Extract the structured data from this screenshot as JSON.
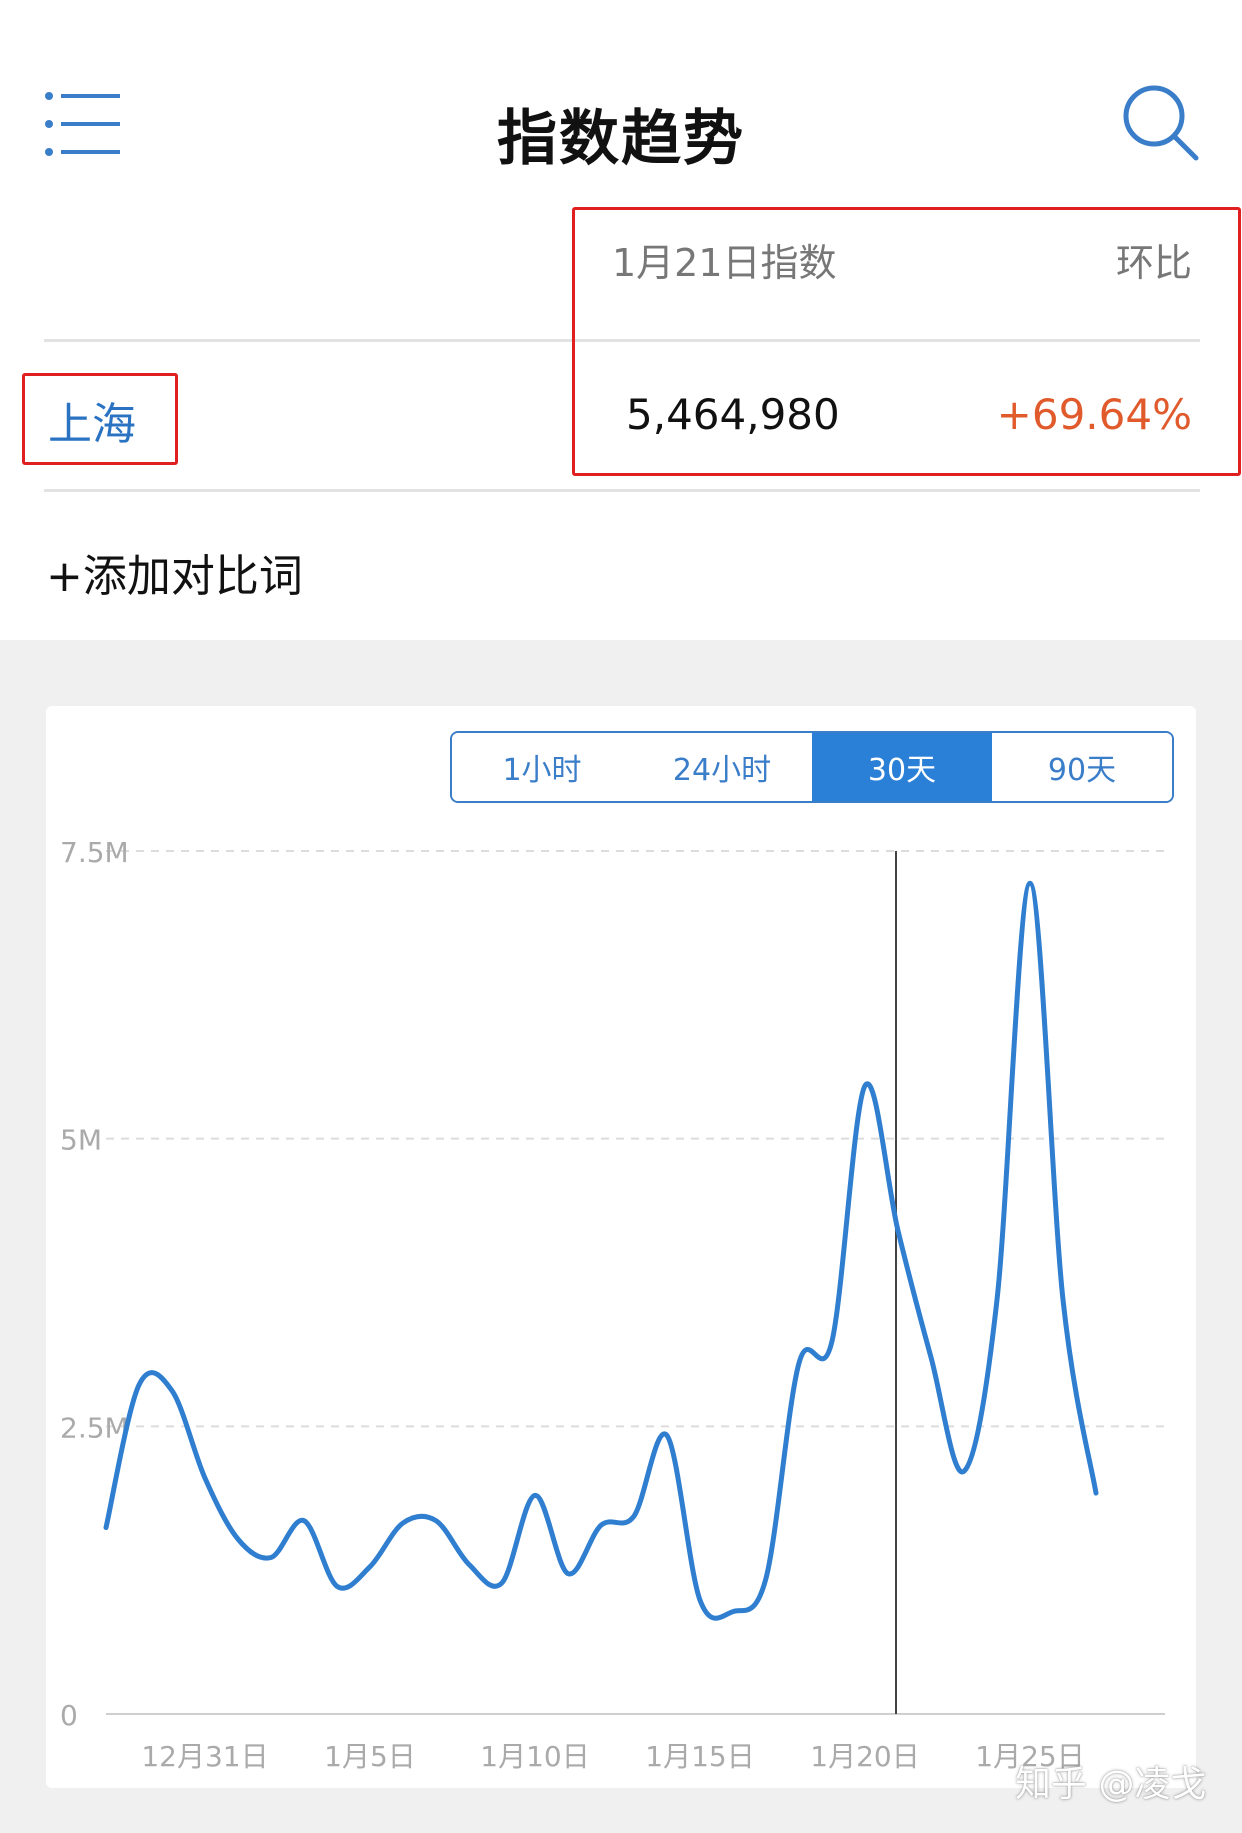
{
  "header": {
    "title": "指数趋势",
    "menu_icon": "list-icon",
    "search_icon": "search-icon"
  },
  "table": {
    "date_header": "1月21日指数",
    "change_header": "环比",
    "term": "上海",
    "value": "5,464,980",
    "change": "+69.64%"
  },
  "add_compare": "+添加对比词",
  "range_tabs": [
    {
      "label": "1小时",
      "active": false
    },
    {
      "label": "24小时",
      "active": false
    },
    {
      "label": "30天",
      "active": true
    },
    {
      "label": "90天",
      "active": false
    }
  ],
  "colors": {
    "accent": "#2a7fd6",
    "line": "#2f7ecf",
    "increase": "#e05a2c",
    "highlight": "#e02020"
  },
  "chart_data": {
    "type": "line",
    "ylim": [
      0,
      7500000
    ],
    "y_ticks": [
      {
        "value": 0,
        "label": "0"
      },
      {
        "value": 2500000,
        "label": "2.5M"
      },
      {
        "value": 5000000,
        "label": "5M"
      },
      {
        "value": 7500000,
        "label": "7.5M"
      }
    ],
    "x_ticks": [
      {
        "day": 5,
        "label": "12月31日"
      },
      {
        "day": 10,
        "label": "1月5日"
      },
      {
        "day": 15,
        "label": "1月10日"
      },
      {
        "day": 20,
        "label": "1月15日"
      },
      {
        "day": 25,
        "label": "1月20日"
      },
      {
        "day": 30,
        "label": "1月25日"
      }
    ],
    "grid": true,
    "marker_day": 26,
    "series": [
      {
        "values": [
          [
            2,
            1620000
          ],
          [
            3,
            2860000
          ],
          [
            4,
            2810000
          ],
          [
            5,
            2050000
          ],
          [
            6,
            1520000
          ],
          [
            7,
            1360000
          ],
          [
            8,
            1680000
          ],
          [
            9,
            1110000
          ],
          [
            10,
            1280000
          ],
          [
            11,
            1660000
          ],
          [
            12,
            1680000
          ],
          [
            13,
            1300000
          ],
          [
            14,
            1140000
          ],
          [
            15,
            1900000
          ],
          [
            16,
            1220000
          ],
          [
            17,
            1640000
          ],
          [
            18,
            1720000
          ],
          [
            19,
            2420000
          ],
          [
            20,
            990000
          ],
          [
            21,
            890000
          ],
          [
            22,
            1180000
          ],
          [
            23,
            3050000
          ],
          [
            24,
            3240000
          ],
          [
            25,
            5460000
          ],
          [
            26,
            4200000
          ],
          [
            27,
            3100000
          ],
          [
            28,
            2110000
          ],
          [
            29,
            3600000
          ],
          [
            30,
            7220000
          ],
          [
            31,
            3600000
          ],
          [
            32,
            1920000
          ]
        ]
      }
    ]
  }
}
